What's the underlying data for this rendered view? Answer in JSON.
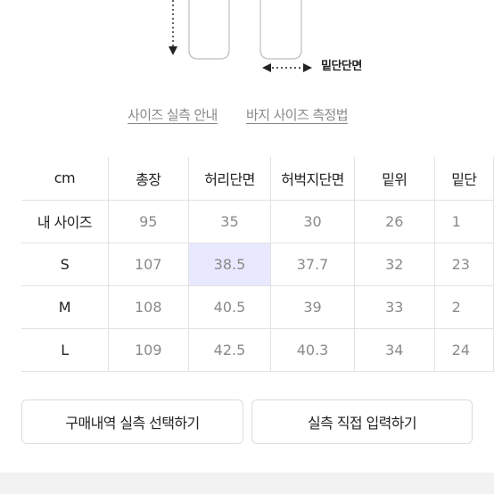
{
  "diagram": {
    "hem_label": "밑단단면"
  },
  "links": {
    "my_size_guide": "사이즈 실측 안내",
    "pants_measure_guide": "바지 사이즈 측정법"
  },
  "table": {
    "headers": [
      "cm",
      "총장",
      "허리단면",
      "허벅지단면",
      "밑위",
      "밑단"
    ],
    "rows": [
      {
        "label": "내 사이즈",
        "cells": [
          "95",
          "35",
          "30",
          "26",
          "1"
        ]
      },
      {
        "label": "S",
        "cells": [
          "107",
          "38.5",
          "37.7",
          "32",
          "23"
        ]
      },
      {
        "label": "M",
        "cells": [
          "108",
          "40.5",
          "39",
          "33",
          "2"
        ]
      },
      {
        "label": "L",
        "cells": [
          "109",
          "42.5",
          "40.3",
          "34",
          "24"
        ]
      }
    ]
  },
  "buttons": {
    "select_purchase": "구매내역 실측 선택하기",
    "enter_direct": "실측 직접 입력하기"
  }
}
